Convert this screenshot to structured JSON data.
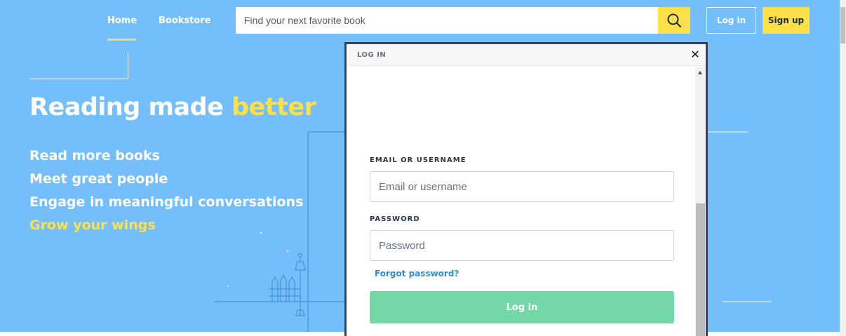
{
  "nav": {
    "home": "Home",
    "bookstore": "Bookstore"
  },
  "search": {
    "placeholder": "Find your next favorite book",
    "button_icon": "search-icon"
  },
  "header_buttons": {
    "login": "Log in",
    "signup": "Sign up"
  },
  "hero": {
    "title_main": "Reading made ",
    "title_accent": "better",
    "taglines": [
      "Read more books",
      "Meet great people",
      "Engage in meaningful conversations",
      "Grow your wings"
    ]
  },
  "modal": {
    "title": "LOG IN",
    "close_icon": "close-icon",
    "email_label": "EMAIL OR USERNAME",
    "email_placeholder": "Email or username",
    "password_label": "PASSWORD",
    "password_placeholder": "Password",
    "forgot": "Forgot password?",
    "submit": "Log in"
  },
  "colors": {
    "background": "#74bffb",
    "accent": "#fde047",
    "modal_border": "#374357",
    "submit_button": "#74d8a6",
    "link": "#2b8fd6"
  }
}
